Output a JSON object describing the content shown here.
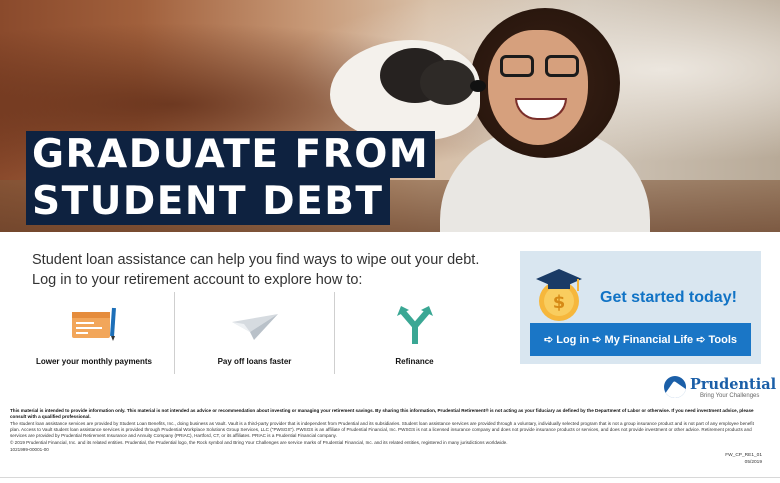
{
  "hero": {
    "headline_line1": "GRADUATE FROM",
    "headline_line2": "STUDENT DEBT"
  },
  "intro": {
    "line1": "Student loan assistance can help you find ways to wipe out your debt.",
    "line2": "Log in to your retirement account to explore how to:"
  },
  "benefits": [
    {
      "label": "Lower your monthly payments",
      "icon": "checkbook-icon"
    },
    {
      "label": "Pay off loans faster",
      "icon": "paper-plane-icon"
    },
    {
      "label": "Refinance",
      "icon": "split-arrow-icon"
    }
  ],
  "cta": {
    "title": "Get started today!",
    "button_label": "➪ Log in ➪ My Financial Life ➪ Tools",
    "icon": "graduation-coin-icon"
  },
  "logo": {
    "name": "Prudential",
    "tagline": "Bring Your Challenges"
  },
  "legal": {
    "disclaimer_bold": "This material is intended to provide information only. This material is not intended as advice or recommendation about investing or managing your retirement savings. By sharing this information, Prudential Retirement® is not acting as your fiduciary as defined by the Department of Labor or otherwise. If you need investment advice, please consult with a qualified professional.",
    "disclaimer_body": "The student loan assistance services are provided by Student Loan Benefits, Inc., doing business as Vault. Vault is a third-party provider that is independent from Prudential and its subsidiaries. Student loan assistance services are provided through a voluntary, individually selected program that is not a group insurance product and is not part of any employee benefit plan. Access to Vault student loan assistance services is provided through Prudential Workplace Solutions Group Services, LLC (\"PWSGS\"). PWSGS is an affiliate of Prudential Financial, Inc. PWSGS is not a licensed insurance company and does not provide insurance products or services, and does not provide investment or other advice. Retirement products and services are provided by Prudential Retirement Insurance and Annuity Company (PRIAC), Hartford, CT, or its affiliates. PRIAC is a Prudential Financial company.",
    "copyright": "© 2019 Prudential Financial, Inc. and its related entities. Prudential, the Prudential logo, the Rock symbol and Bring Your Challenges are service marks of Prudential Financial, Inc. and its related entities, registered in many jurisdictions worldwide.",
    "code_left": "1021999-00001-00",
    "code_right": "FW_CP_RE1_01",
    "date_right": "05/2019"
  },
  "colors": {
    "navy": "#0e2240",
    "brand_blue": "#1a76c6",
    "cta_bg": "#d9e6f0",
    "refinance_green": "#3aa794"
  }
}
